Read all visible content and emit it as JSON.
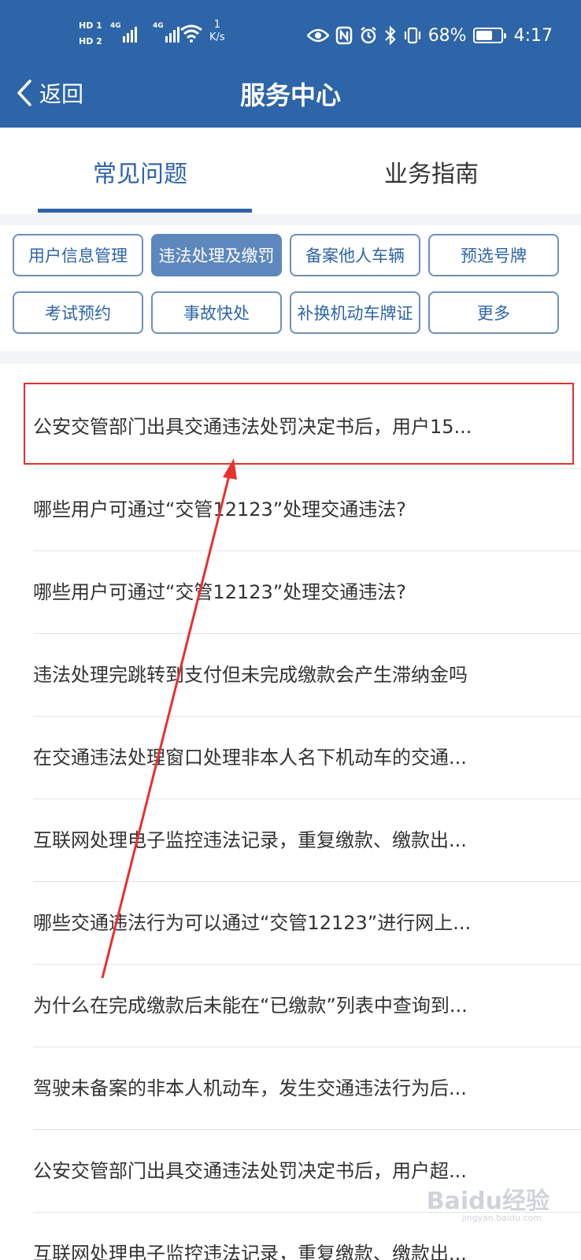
{
  "status_bar": {
    "hd1": "HD 1",
    "hd2": "HD 2",
    "net1": "4G",
    "net2": "4G",
    "speed_value": "1",
    "speed_unit": "K/s",
    "battery_percent": "68%",
    "battery_level": 0.68,
    "time": "4:17",
    "icons": [
      "eye-icon",
      "nfc-icon",
      "alarm-icon",
      "bluetooth-icon",
      "vibrate-icon"
    ]
  },
  "header": {
    "back_label": "返回",
    "title": "服务中心",
    "bg_color": "#2e64a8"
  },
  "tabs": [
    {
      "label": "常见问题",
      "active": true
    },
    {
      "label": "业务指南",
      "active": false
    }
  ],
  "categories": [
    {
      "label": "用户信息管理",
      "active": false
    },
    {
      "label": "违法处理及缴罚",
      "active": true
    },
    {
      "label": "备案他人车辆",
      "active": false
    },
    {
      "label": "预选号牌",
      "active": false
    },
    {
      "label": "考试预约",
      "active": false
    },
    {
      "label": "事故快处",
      "active": false
    },
    {
      "label": "补换机动车牌证",
      "active": false
    },
    {
      "label": "更多",
      "active": false
    }
  ],
  "questions": [
    "公安交管部门出具交通违法处罚决定书后，用户15...",
    "哪些用户可通过“交管12123”处理交通违法?",
    "哪些用户可通过“交管12123”处理交通违法?",
    "违法处理完跳转到支付但未完成缴款会产生滞纳金吗",
    "在交通违法处理窗口处理非本人名下机动车的交通...",
    "互联网处理电子监控违法记录，重复缴款、缴款出...",
    "哪些交通违法行为可以通过“交管12123”进行网上...",
    "为什么在完成缴款后未能在“已缴款”列表中查询到...",
    "驾驶未备案的非本人机动车，发生交通违法行为后...",
    "公安交管部门出具交通违法处罚决定书后，用户超...",
    "互联网处理电子监控违法记录，重复缴款、缴款出..."
  ],
  "annotation": {
    "color": "#e8302f"
  },
  "watermark": {
    "text": "Baidu经验",
    "sub": "jingyan.baidu.com"
  }
}
